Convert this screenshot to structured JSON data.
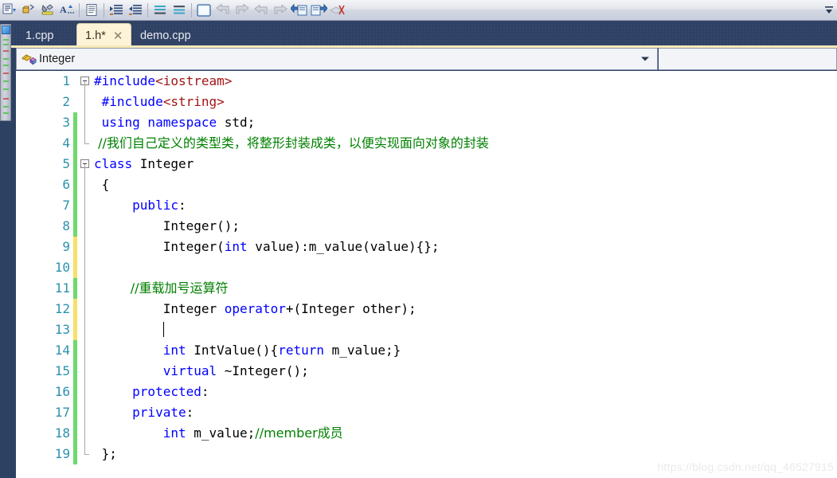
{
  "toolbar": {
    "buttons": [
      {
        "name": "comment-selection-icon",
        "glyph": "≡"
      },
      {
        "name": "uncomment-selection-icon",
        "glyph": "≡"
      },
      {
        "name": "highlight-icon",
        "glyph": "✐"
      },
      {
        "name": "font-size-icon",
        "glyph": "A"
      },
      {
        "name": "toggle-word-wrap-icon",
        "glyph": "☰"
      },
      {
        "name": "increase-indent-icon",
        "glyph": "⇥"
      },
      {
        "name": "decrease-indent-icon",
        "glyph": "⇤"
      },
      {
        "name": "align-top-icon",
        "glyph": "═"
      },
      {
        "name": "align-bottom-icon",
        "glyph": "═"
      },
      {
        "name": "new-window-icon",
        "glyph": "□"
      },
      {
        "name": "undo-arrow-icon",
        "glyph": "↶"
      },
      {
        "name": "redo-arrow-icon",
        "glyph": "↷"
      },
      {
        "name": "navigate-backward-icon",
        "glyph": "↩"
      },
      {
        "name": "navigate-forward-icon",
        "glyph": "↪"
      },
      {
        "name": "sync-back-icon",
        "glyph": "⇐"
      },
      {
        "name": "sync-forward-icon",
        "glyph": "⇒"
      },
      {
        "name": "clear-bookmarks-icon",
        "glyph": "✖"
      }
    ],
    "overflow_label": "▾"
  },
  "tabs": [
    {
      "label": "1.cpp",
      "active": false,
      "closable": false
    },
    {
      "label": "1.h*",
      "active": true,
      "closable": true,
      "close_glyph": "✕"
    },
    {
      "label": "demo.cpp",
      "active": false,
      "closable": false
    }
  ],
  "navbar": {
    "scope_text": "Integer",
    "scope_icon": "class-member-icon",
    "dropdown_glyph": "▾",
    "member_text": ""
  },
  "editor": {
    "lines": [
      {
        "num": "1",
        "change": "none",
        "fold": "open",
        "tokens": [
          {
            "t": "pre",
            "v": "#include"
          },
          {
            "t": "str",
            "v": "<iostream>"
          }
        ]
      },
      {
        "num": "2",
        "change": "none",
        "fold": "line",
        "tokens": [
          {
            "t": "pre",
            "v": " #include"
          },
          {
            "t": "str",
            "v": "<string>"
          }
        ]
      },
      {
        "num": "3",
        "change": "added",
        "fold": "line",
        "tokens": [
          {
            "t": "kw",
            "v": " using namespace "
          },
          {
            "t": "plain",
            "v": "std;"
          }
        ]
      },
      {
        "num": "4",
        "change": "added",
        "fold": "endline",
        "tokens": [
          {
            "t": "cmt",
            "v": " //我们自己定义的类型类，将整形封装成类，以便实现面向对象的封装"
          }
        ]
      },
      {
        "num": "5",
        "change": "added",
        "fold": "open",
        "tokens": [
          {
            "t": "kw",
            "v": "class "
          },
          {
            "t": "plain",
            "v": "Integer"
          }
        ]
      },
      {
        "num": "6",
        "change": "added",
        "fold": "line",
        "tokens": [
          {
            "t": "plain",
            "v": " {"
          }
        ]
      },
      {
        "num": "7",
        "change": "added",
        "fold": "line",
        "tokens": [
          {
            "t": "kw",
            "v": "     public"
          },
          {
            "t": "plain",
            "v": ":"
          }
        ]
      },
      {
        "num": "8",
        "change": "added",
        "fold": "line",
        "tokens": [
          {
            "t": "plain",
            "v": "         Integer();"
          }
        ]
      },
      {
        "num": "9",
        "change": "edited",
        "fold": "line",
        "tokens": [
          {
            "t": "plain",
            "v": "         Integer("
          },
          {
            "t": "kw",
            "v": "int"
          },
          {
            "t": "plain",
            "v": " value):m_value(value){};"
          }
        ]
      },
      {
        "num": "10",
        "change": "edited",
        "fold": "line",
        "tokens": [
          {
            "t": "plain",
            "v": ""
          }
        ]
      },
      {
        "num": "11",
        "change": "added",
        "fold": "line",
        "tokens": [
          {
            "t": "cmt",
            "v": "         //重载加号运算符"
          }
        ]
      },
      {
        "num": "12",
        "change": "edited",
        "fold": "line",
        "tokens": [
          {
            "t": "plain",
            "v": "         Integer "
          },
          {
            "t": "kw",
            "v": "operator"
          },
          {
            "t": "plain",
            "v": "+(Integer other);"
          }
        ]
      },
      {
        "num": "13",
        "change": "edited",
        "fold": "line",
        "caret": true,
        "tokens": [
          {
            "t": "plain",
            "v": "         "
          }
        ]
      },
      {
        "num": "14",
        "change": "added",
        "fold": "line",
        "tokens": [
          {
            "t": "kw",
            "v": "         int"
          },
          {
            "t": "plain",
            "v": " IntValue(){"
          },
          {
            "t": "kw",
            "v": "return"
          },
          {
            "t": "plain",
            "v": " m_value;}"
          }
        ]
      },
      {
        "num": "15",
        "change": "added",
        "fold": "line",
        "tokens": [
          {
            "t": "kw",
            "v": "         virtual"
          },
          {
            "t": "plain",
            "v": " ~Integer();"
          }
        ]
      },
      {
        "num": "16",
        "change": "added",
        "fold": "line",
        "tokens": [
          {
            "t": "kw",
            "v": "     protected"
          },
          {
            "t": "plain",
            "v": ":"
          }
        ]
      },
      {
        "num": "17",
        "change": "added",
        "fold": "line",
        "tokens": [
          {
            "t": "kw",
            "v": "     private"
          },
          {
            "t": "plain",
            "v": ":"
          }
        ]
      },
      {
        "num": "18",
        "change": "added",
        "fold": "line",
        "tokens": [
          {
            "t": "kw",
            "v": "         int"
          },
          {
            "t": "plain",
            "v": " m_value;"
          },
          {
            "t": "cmt",
            "v": "//member成员"
          }
        ]
      },
      {
        "num": "19",
        "change": "added",
        "fold": "endline",
        "tokens": [
          {
            "t": "plain",
            "v": " };"
          }
        ]
      }
    ]
  },
  "watermark": {
    "text": "https://blog.csdn.net/qq_46527915"
  },
  "colors": {
    "chrome_blue": "#2f4164",
    "tab_active_bg": "#fdf4d8",
    "keyword": "#0000ff",
    "comment": "#008000",
    "string": "#a31515",
    "linenumber": "#2b91af",
    "change_added": "#6fd86f",
    "change_edited": "#f5e06a"
  }
}
